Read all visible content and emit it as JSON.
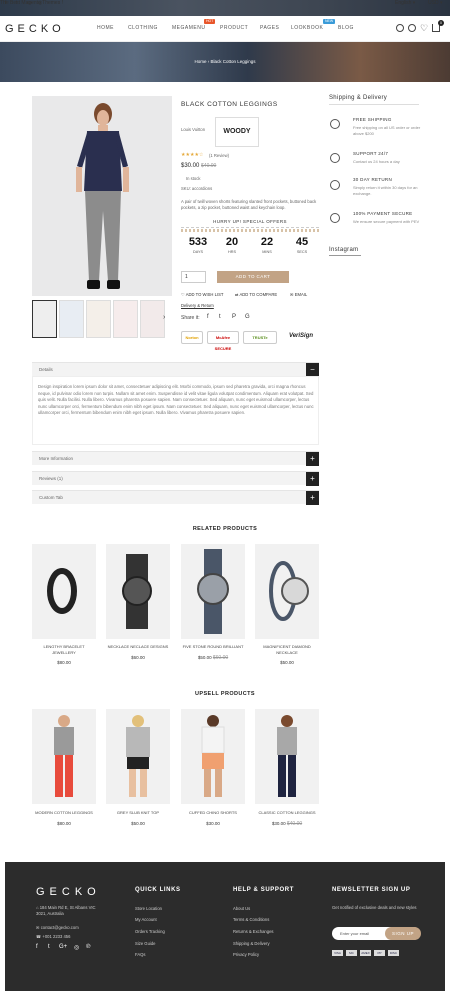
{
  "topbar": {
    "promo": "The Best Magento Themes !",
    "language": "English ▾",
    "currency": "USD ▾",
    "social": [
      "f",
      "t",
      "G+",
      "◎"
    ]
  },
  "header": {
    "logo": "GECKO",
    "nav": [
      "HOME",
      "CLOTHING",
      "MEGAMENU",
      "PRODUCT",
      "PAGES",
      "LOOKBOOK",
      "BLOG"
    ],
    "badges": {
      "megamenu": "HOT",
      "lookbook": "NEW"
    },
    "cart_count": "0"
  },
  "breadcrumb": {
    "home": "Home",
    "sep": "›",
    "current": "Black Cotton Leggings"
  },
  "product": {
    "title": "BLACK COTTON LEGGINGS",
    "brand_label": "Louis Vuitton",
    "brand_logo_text": "WOODY",
    "stars": "★★★★☆",
    "reviews": "(1 Review)",
    "price": "$30.00",
    "old_price": "$40.00",
    "stock": "In stock",
    "sku": "SKU: accordions",
    "short_desc": "A pair of twill woven shorts featuring slanted front pockets, buttoned back pockets, a zip pocket, buttoned waist and keychain loop.",
    "hurry": "HURRY UP! SPECIAL OFFERS",
    "countdown": [
      {
        "n": "533",
        "l": "DAYS"
      },
      {
        "n": "20",
        "l": "HRS"
      },
      {
        "n": "22",
        "l": "MINS"
      },
      {
        "n": "45",
        "l": "SECS"
      }
    ],
    "qty": "1",
    "add_to_cart": "ADD TO CART",
    "wishlist": "ADD TO WISH LIST",
    "compare": "ADD TO COMPARE",
    "email": "EMAIL",
    "delivery": "Delivery & Return",
    "share": "Share it:",
    "trust": [
      "Norton",
      "McAfee SECURE",
      "TRUSTe",
      "VeriSign"
    ]
  },
  "sidebar": {
    "heading": "Shipping & Delivery",
    "features": [
      {
        "icon": "truck-icon",
        "title": "FREE SHIPPING",
        "desc": "Free shipping on all US order or order above $200"
      },
      {
        "icon": "support-icon",
        "title": "SUPPORT 24/7",
        "desc": "Contact us 24 hours a day"
      },
      {
        "icon": "return-icon",
        "title": "30 DAY RETURN",
        "desc": "Simply return it within 30 days for an exchange."
      },
      {
        "icon": "secure-icon",
        "title": "100% PAYMENT SECURE",
        "desc": "We ensure secure payment with PEV"
      }
    ],
    "instagram": "Instagram"
  },
  "tabs": {
    "details": "Details",
    "details_text": "Design inspiration lorem ipsum dolor sit amet, consectetuer adipiscing elit. Morbi commodo, ipsum sed pharetra gravida, orci magna rhoncus neque, id pulvinar odio lorem non turpis. Nullam sit amet enim. Suspendisse id velit vitae ligula volutpat condimentum. Aliquam erat volutpat. Sed quis velit. Nulla facilisi. Nulla libero. Vivamus pharetra posuere sapien. Nam consectetuer. Sed aliquam, nunc eget euismod ullamcorper, lectus nunc ullamcorper orci, fermentum bibendum enim nibh eget ipsum. Nam consectetuer. Sed aliquam, nunc eget euismod ullamcorper, lectus nunc ullamcorper orci, fermentum bibendum enim nibh eget ipsum. Nulla libero. Vivamus pharetra posuere sapien.",
    "more_info": "More Information",
    "reviews": "Reviews (1)",
    "custom": "Custom Tab"
  },
  "related": {
    "heading": "RELATED PRODUCTS",
    "items": [
      {
        "name": "LENGTHY BRACELET JEWELLERY",
        "price": "$80.00",
        "old": ""
      },
      {
        "name": "NECKLACE NECLACE DESIGNS",
        "price": "$60.00",
        "old": ""
      },
      {
        "name": "FIVE STONE ROUND BRILLIANT",
        "price": "$50.00",
        "old": "$60.00"
      },
      {
        "name": "MAGNIFICENT DIAMOND NECKLACE",
        "price": "$50.00",
        "old": ""
      }
    ]
  },
  "upsell": {
    "heading": "UPSELL PRODUCTS",
    "items": [
      {
        "name": "MODERN COTTON LEGGINGS",
        "price": "$80.00",
        "old": ""
      },
      {
        "name": "GREY SLUB KNIT TOP",
        "price": "$50.00",
        "old": ""
      },
      {
        "name": "CUFFED CHINO SHORTS",
        "price": "$30.00",
        "old": ""
      },
      {
        "name": "CLASSIC COTTON LEGGINGS",
        "price": "$30.00",
        "old": "$40.00"
      }
    ]
  },
  "footer": {
    "logo": "GECKO",
    "address": "184 Main Rd E, St Albans VIC 3021, Australia",
    "email": "contact@gecko.com",
    "phone": "+001 2233 456",
    "quick_links_title": "QUICK LINKS",
    "quick_links": [
      "Store Location",
      "My Account",
      "Orders Tracking",
      "Size Guide",
      "FAQs"
    ],
    "help_title": "HELP & SUPPORT",
    "help": [
      "About Us",
      "Terms & Conditions",
      "Returns & Exchanges",
      "Shipping & Delivery",
      "Privacy Policy"
    ],
    "newsletter_title": "NEWSLETTER SIGN UP",
    "newsletter_desc": "Get notified of exclusive deals and new styles",
    "email_placeholder": "Enter your email",
    "signup": "SIGN UP",
    "payments": [
      "VISA",
      "MC",
      "AMEX",
      "PP",
      "DISC"
    ]
  },
  "colors": {
    "accent": "#c2a385",
    "dark": "#222222",
    "footer": "#2c2c2c"
  }
}
